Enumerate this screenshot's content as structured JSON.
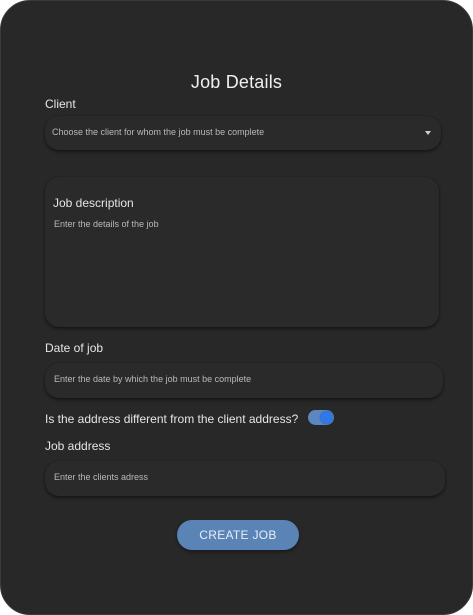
{
  "form": {
    "title": "Job Details",
    "client": {
      "label": "Client",
      "placeholder": "Choose the client for whom the job must be complete",
      "icon": "dropdown-caret-icon"
    },
    "description": {
      "label": "Job description",
      "placeholder": "Enter the details of the job"
    },
    "date": {
      "label": "Date of job",
      "placeholder": "Enter the date by which the job must be complete"
    },
    "address_toggle": {
      "label": "Is the address different from the client address?",
      "checked": true
    },
    "address": {
      "label": "Job address",
      "placeholder": "Enter the clients adress"
    },
    "submit_label": "CREATE JOB"
  },
  "colors": {
    "card_background": "#282828",
    "accent": "#5a83b6",
    "toggle_knob": "#2f78e6"
  }
}
